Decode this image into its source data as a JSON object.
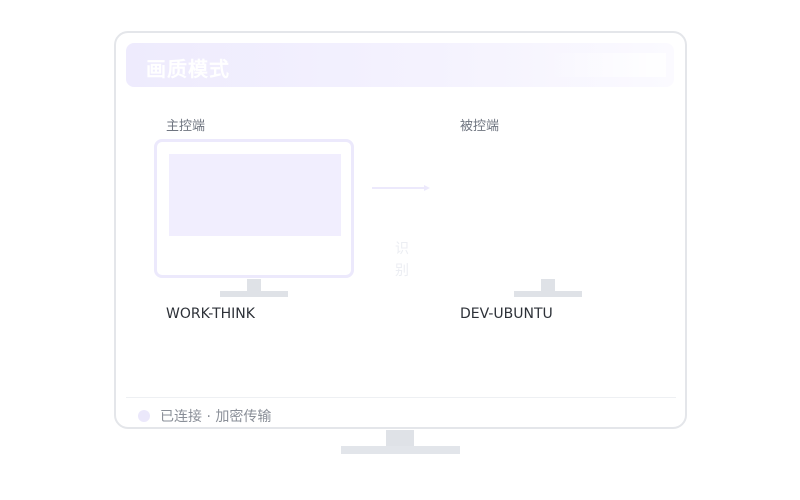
{
  "header": {
    "title": "画质模式"
  },
  "controller": {
    "role_label": "主控端",
    "device_name": "WORK-THINK"
  },
  "controlled": {
    "role_label": "被控端",
    "device_name": "DEV-UBUNTU"
  },
  "link": {
    "caption_line1": "识",
    "caption_line2": "别"
  },
  "status": {
    "text": "已连接 · 加密传输"
  },
  "colors": {
    "accent": "#ece9fc",
    "header_bg": "#eeebfd",
    "status_dot": "#ebe8fb",
    "stand": "#dfe2e7"
  },
  "icons": {
    "arrow": "arrow-right-icon",
    "status": "status-dot-icon"
  }
}
